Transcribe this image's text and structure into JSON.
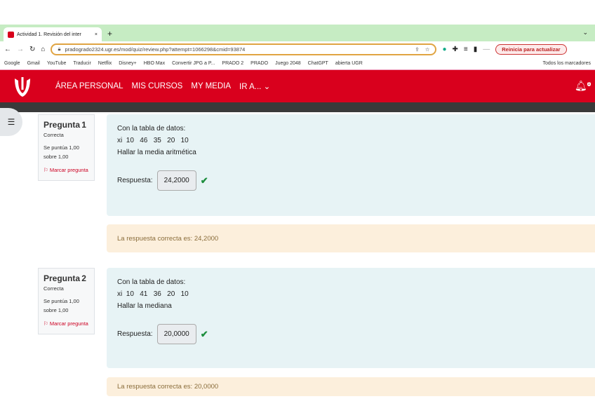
{
  "browser": {
    "tab_title": "Actividad 1. Revisión del inter",
    "url": "pradogrado2324.ugr.es/mod/quiz/review.php?attempt=1066298&cmid=93874",
    "restart_label": "Reinicia para actualizar",
    "bookmarks": [
      "Google",
      "Gmail",
      "YouTube",
      "Traducir",
      "Netflix",
      "Disney+",
      "HBO Max",
      "Convertir JPG a P...",
      "PRADO 2",
      "PRADO",
      "Juego 2048",
      "ChatGPT",
      "abierta UGR",
      "Todos los marcadores"
    ]
  },
  "nav": {
    "items": [
      "ÁREA PERSONAL",
      "MIS CURSOS",
      "MY MEDIA",
      "IR A..."
    ],
    "notif_count": "1"
  },
  "questions": [
    {
      "label": "Pregunta",
      "number": "1",
      "status": "Correcta",
      "score": "Se puntúa 1,00",
      "max": "sobre 1,00",
      "flag": "Marcar pregunta",
      "line1": "Con la tabla de datos:",
      "line2": "xi  10   46   35   20   10",
      "line3": "Hallar la media aritmética",
      "answer_label": "Respuesta:",
      "answer": "24,2000",
      "feedback": "La respuesta correcta es: 24,2000"
    },
    {
      "label": "Pregunta",
      "number": "2",
      "status": "Correcta",
      "score": "Se puntúa 1,00",
      "max": "sobre 1,00",
      "flag": "Marcar pregunta",
      "line1": "Con la tabla de datos:",
      "line2": "xi  10   41   36   20   10",
      "line3": "Hallar la mediana",
      "answer_label": "Respuesta:",
      "answer": "20,0000",
      "feedback": "La respuesta correcta es: 20,0000"
    }
  ]
}
